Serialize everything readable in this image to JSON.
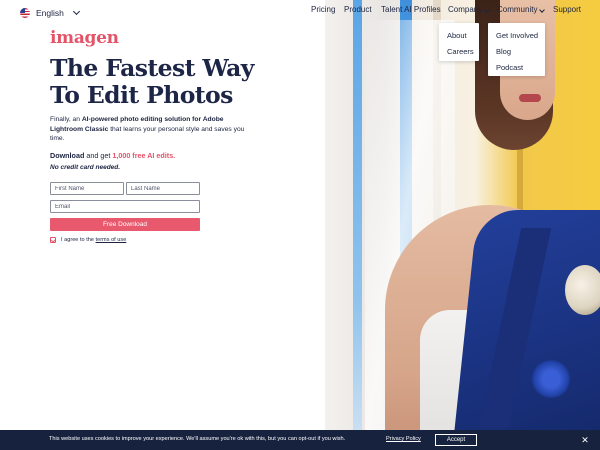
{
  "language": {
    "label": "English",
    "flag_icon": "us-flag-icon"
  },
  "nav": {
    "pricing": "Pricing",
    "product": "Product",
    "talent_profiles": "Talent AI Profiles",
    "company": "Company",
    "community": "Community",
    "support": "Support"
  },
  "company_menu": [
    "About",
    "Careers"
  ],
  "community_menu": [
    "Get Involved",
    "Blog",
    "Podcast"
  ],
  "brand": {
    "logo": "imagen",
    "color": "#e35468"
  },
  "hero": {
    "headline_line1": "The Fastest Way",
    "headline_line2": "To Edit Photos",
    "sub_prefix": "Finally, an ",
    "sub_bold": "AI-powered photo editing solution for Adobe Lightroom Classic",
    "sub_suffix": " that learns your personal style and saves you time.",
    "download_bold": "Download",
    "download_mid": " and get ",
    "download_pink": "1,000 free AI edits.",
    "no_credit": "No credit card needed."
  },
  "form": {
    "first_name_placeholder": "First Name",
    "last_name_placeholder": "Last Name",
    "email_placeholder": "Email",
    "submit_label": "Free Download",
    "terms_prefix": "I agree to the ",
    "terms_link": "terms of use",
    "terms_checked": true
  },
  "cookie": {
    "text": "This website uses cookies to improve your experience. We'll assume you're ok with this, but you can opt-out if you wish.",
    "policy_link": "Privacy Policy",
    "accept_label": "Accept",
    "close_symbol": "✕"
  },
  "colors": {
    "navy": "#1d2646",
    "pink": "#e9596d",
    "cookie_bg": "#17223f"
  }
}
